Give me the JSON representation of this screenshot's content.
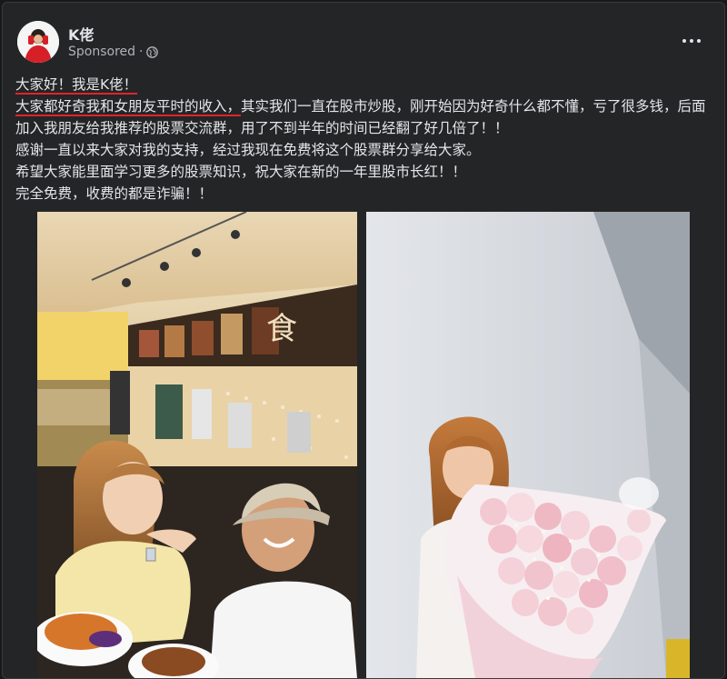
{
  "post": {
    "author": "K佬",
    "sponsored_label": "Sponsored",
    "separator": "·",
    "privacy_icon": "globe-icon",
    "more_icon": "more-dots-icon",
    "text": {
      "line1": "大家好！我是K佬！",
      "line2_underlined": "大家都好奇我和女朋友平时的收入，",
      "line2_rest": "其实我们一直在股市炒股，刚开始因为好奇什么都不懂，亏了很多钱，后面加入我朋友给我推荐的股票交流群，用了不到半年的时间已经翻了好几倍了！！",
      "line3": "感谢一直以来大家对我的支持，经过我现在免费将这个股票群分享给大家。",
      "line4": "希望大家能里面学习更多的股票知识，祝大家在新的一年里股市长红！！",
      "line5": "完全免费，收费的都是诈骗！！"
    },
    "colors": {
      "background": "#242526",
      "text": "#e4e6eb",
      "secondary_text": "#b0b3b8",
      "underline": "#e0242a"
    }
  }
}
